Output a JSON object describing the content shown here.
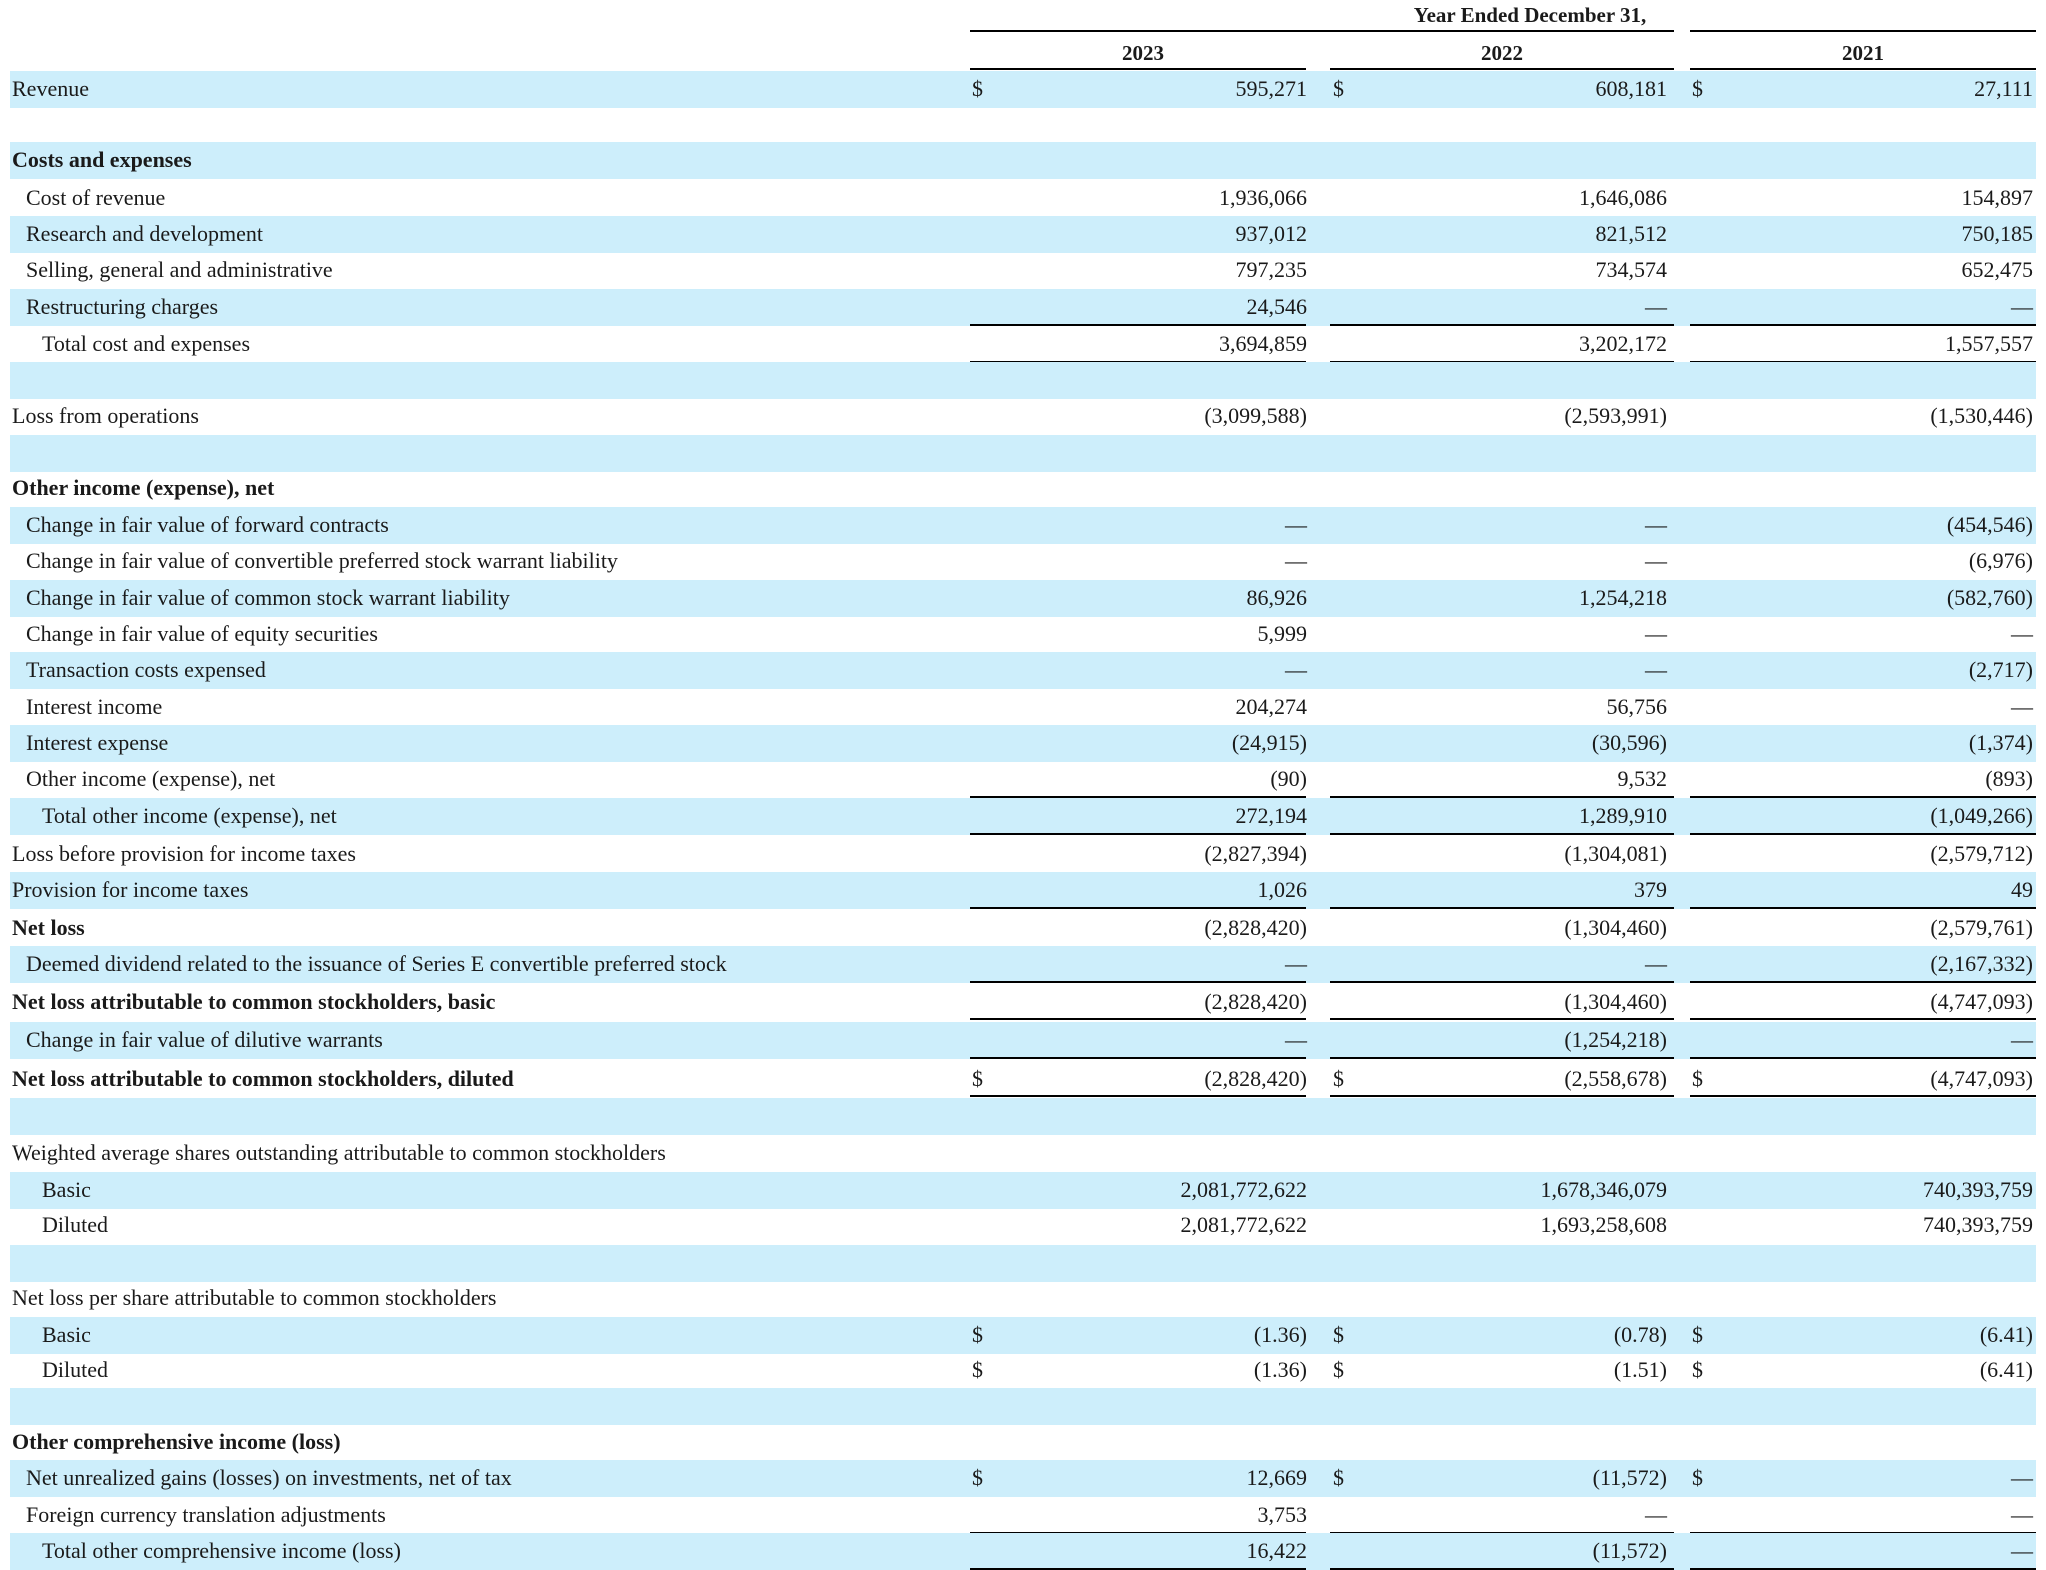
{
  "header": {
    "period": "Year Ended December 31,",
    "years": [
      "2023",
      "2022",
      "2021"
    ]
  },
  "rows": [
    {
      "label": "Revenue",
      "indent": 0,
      "bold": false,
      "shade": true,
      "values": [
        "595,271",
        "608,181",
        "27,111"
      ],
      "currency": true
    },
    {
      "label": "",
      "indent": 0,
      "bold": false,
      "shade": false,
      "values": [
        "",
        "",
        ""
      ]
    },
    {
      "label": "Costs and expenses",
      "indent": 0,
      "bold": true,
      "shade": true,
      "values": [
        "",
        "",
        ""
      ]
    },
    {
      "label": "Cost of revenue",
      "indent": 1,
      "bold": false,
      "shade": false,
      "values": [
        "1,936,066",
        "1,646,086",
        "154,897"
      ]
    },
    {
      "label": "Research and development",
      "indent": 1,
      "bold": false,
      "shade": true,
      "values": [
        "937,012",
        "821,512",
        "750,185"
      ]
    },
    {
      "label": "Selling, general and administrative",
      "indent": 1,
      "bold": false,
      "shade": false,
      "values": [
        "797,235",
        "734,574",
        "652,475"
      ]
    },
    {
      "label": "Restructuring charges",
      "indent": 1,
      "bold": false,
      "shade": true,
      "values": [
        "24,546",
        "—",
        "—"
      ],
      "rule_below": "single"
    },
    {
      "label": "Total cost and expenses",
      "indent": 2,
      "bold": false,
      "shade": false,
      "values": [
        "3,694,859",
        "3,202,172",
        "1,557,557"
      ],
      "rule_below": "single"
    },
    {
      "label": "",
      "indent": 0,
      "bold": false,
      "shade": true,
      "values": [
        "",
        "",
        ""
      ]
    },
    {
      "label": "Loss from operations",
      "indent": 0,
      "bold": false,
      "shade": false,
      "values": [
        "(3,099,588)",
        "(2,593,991)",
        "(1,530,446)"
      ]
    },
    {
      "label": "",
      "indent": 0,
      "bold": false,
      "shade": true,
      "values": [
        "",
        "",
        ""
      ]
    },
    {
      "label": "Other income (expense), net",
      "indent": 0,
      "bold": true,
      "shade": false,
      "values": [
        "",
        "",
        ""
      ]
    },
    {
      "label": "Change in fair value of forward contracts",
      "indent": 1,
      "bold": false,
      "shade": true,
      "values": [
        "—",
        "—",
        "(454,546)"
      ]
    },
    {
      "label": "Change in fair value of convertible preferred stock warrant liability",
      "indent": 1,
      "bold": false,
      "shade": false,
      "values": [
        "—",
        "—",
        "(6,976)"
      ]
    },
    {
      "label": "Change in fair value of common stock warrant liability",
      "indent": 1,
      "bold": false,
      "shade": true,
      "values": [
        "86,926",
        "1,254,218",
        "(582,760)"
      ]
    },
    {
      "label": "Change in fair value of equity securities",
      "indent": 1,
      "bold": false,
      "shade": false,
      "values": [
        "5,999",
        "—",
        "—"
      ]
    },
    {
      "label": "Transaction costs expensed",
      "indent": 1,
      "bold": false,
      "shade": true,
      "values": [
        "—",
        "—",
        "(2,717)"
      ]
    },
    {
      "label": "Interest income",
      "indent": 1,
      "bold": false,
      "shade": false,
      "values": [
        "204,274",
        "56,756",
        "—"
      ]
    },
    {
      "label": "Interest expense",
      "indent": 1,
      "bold": false,
      "shade": true,
      "values": [
        "(24,915)",
        "(30,596)",
        "(1,374)"
      ]
    },
    {
      "label": "Other income (expense), net",
      "indent": 1,
      "bold": false,
      "shade": false,
      "values": [
        "(90)",
        "9,532",
        "(893)"
      ],
      "rule_below": "single"
    },
    {
      "label": "Total other income (expense), net",
      "indent": 2,
      "bold": false,
      "shade": true,
      "values": [
        "272,194",
        "1,289,910",
        "(1,049,266)"
      ],
      "rule_below": "single"
    },
    {
      "label": "Loss before provision for income taxes",
      "indent": 0,
      "bold": false,
      "shade": false,
      "values": [
        "(2,827,394)",
        "(1,304,081)",
        "(2,579,712)"
      ]
    },
    {
      "label": "Provision for income taxes",
      "indent": 0,
      "bold": false,
      "shade": true,
      "values": [
        "1,026",
        "379",
        "49"
      ],
      "rule_below": "single"
    },
    {
      "label": "Net loss",
      "indent": 0,
      "bold": true,
      "shade": false,
      "values": [
        "(2,828,420)",
        "(1,304,460)",
        "(2,579,761)"
      ]
    },
    {
      "label": "Deemed dividend related to the issuance of Series E convertible preferred stock",
      "indent": 1,
      "bold": false,
      "shade": true,
      "values": [
        "—",
        "—",
        "(2,167,332)"
      ],
      "rule_below": "single"
    },
    {
      "label": "Net loss attributable to common stockholders, basic",
      "indent": 0,
      "bold": true,
      "shade": false,
      "values": [
        "(2,828,420)",
        "(1,304,460)",
        "(4,747,093)"
      ],
      "rule_below": "double"
    },
    {
      "label": "Change in fair value of dilutive warrants",
      "indent": 1,
      "bold": false,
      "shade": true,
      "values": [
        "—",
        "(1,254,218)",
        "—"
      ],
      "rule_below": "single"
    },
    {
      "label": "Net loss attributable to common stockholders, diluted",
      "indent": 0,
      "bold": true,
      "shade": false,
      "values": [
        "(2,828,420)",
        "(2,558,678)",
        "(4,747,093)"
      ],
      "currency": true,
      "rule_below": "double"
    },
    {
      "label": "",
      "indent": 0,
      "bold": false,
      "shade": true,
      "values": [
        "",
        "",
        ""
      ]
    },
    {
      "label": "Weighted average shares outstanding attributable to common stockholders",
      "indent": 0,
      "bold": false,
      "shade": false,
      "values": [
        "",
        "",
        ""
      ]
    },
    {
      "label": "Basic",
      "indent": 2,
      "bold": false,
      "shade": true,
      "values": [
        "2,081,772,622",
        "1,678,346,079",
        "740,393,759"
      ]
    },
    {
      "label": "Diluted",
      "indent": 2,
      "bold": false,
      "shade": false,
      "values": [
        "2,081,772,622",
        "1,693,258,608",
        "740,393,759"
      ]
    },
    {
      "label": "",
      "indent": 0,
      "bold": false,
      "shade": true,
      "values": [
        "",
        "",
        ""
      ]
    },
    {
      "label": "Net loss per share attributable to common stockholders",
      "indent": 0,
      "bold": false,
      "shade": false,
      "values": [
        "",
        "",
        ""
      ]
    },
    {
      "label": "Basic",
      "indent": 2,
      "bold": false,
      "shade": true,
      "values": [
        "(1.36)",
        "(0.78)",
        "(6.41)"
      ],
      "currency": true
    },
    {
      "label": "Diluted",
      "indent": 2,
      "bold": false,
      "shade": false,
      "values": [
        "(1.36)",
        "(1.51)",
        "(6.41)"
      ],
      "currency": true
    },
    {
      "label": "",
      "indent": 0,
      "bold": false,
      "shade": true,
      "values": [
        "",
        "",
        ""
      ]
    },
    {
      "label": "Other comprehensive income (loss)",
      "indent": 0,
      "bold": true,
      "shade": false,
      "values": [
        "",
        "",
        ""
      ]
    },
    {
      "label": "Net unrealized gains (losses) on investments, net of tax",
      "indent": 1,
      "bold": false,
      "shade": true,
      "values": [
        "12,669",
        "(11,572)",
        "—"
      ],
      "currency": true
    },
    {
      "label": "Foreign currency translation adjustments",
      "indent": 1,
      "bold": false,
      "shade": false,
      "values": [
        "3,753",
        "—",
        "—"
      ],
      "rule_below": "single"
    },
    {
      "label": "Total other comprehensive income (loss)",
      "indent": 2,
      "bold": false,
      "shade": true,
      "values": [
        "16,422",
        "(11,572)",
        "—"
      ],
      "rule_below": "single"
    }
  ],
  "currency_symbol": "$"
}
